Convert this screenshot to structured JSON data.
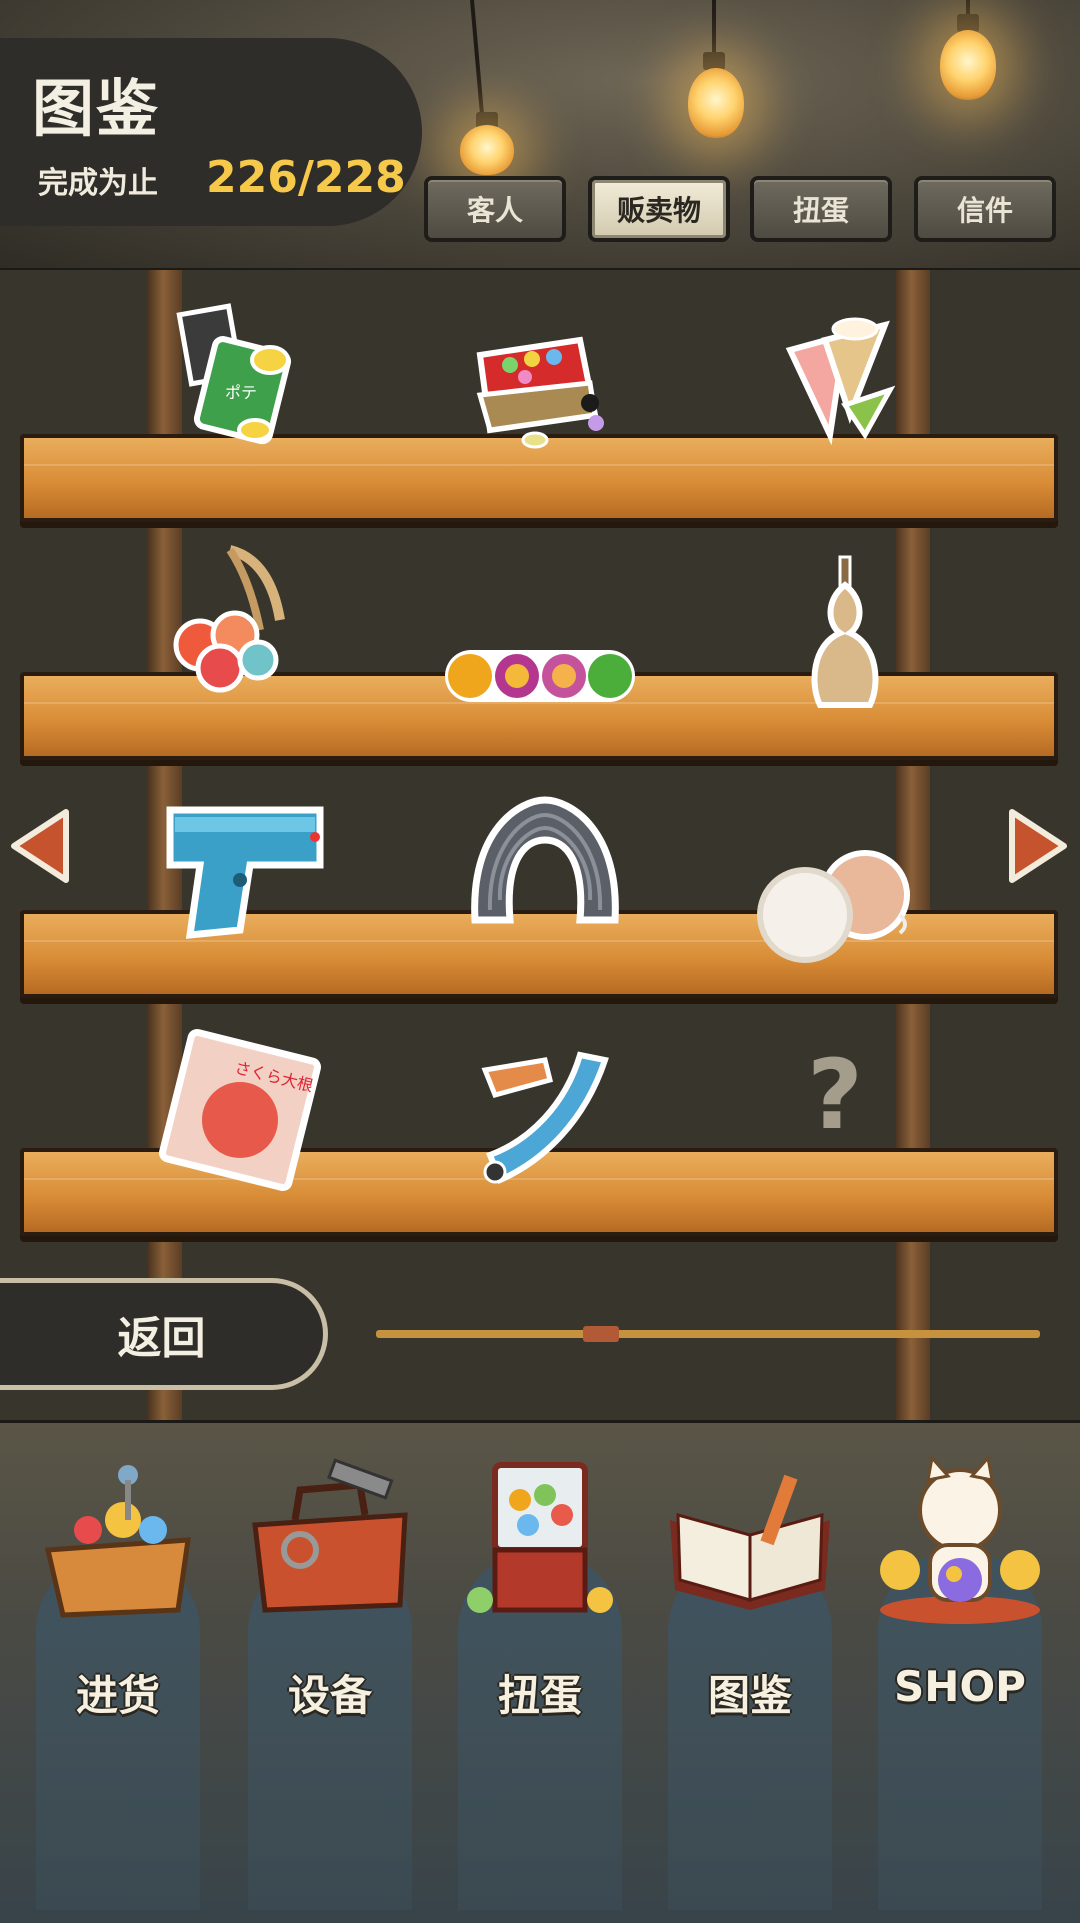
{
  "header": {
    "title": "图鉴",
    "progress_label": "完成为止",
    "progress_value": "226/228"
  },
  "tabs": [
    {
      "label": "客人",
      "active": false
    },
    {
      "label": "贩卖物",
      "active": true
    },
    {
      "label": "扭蛋",
      "active": false
    },
    {
      "label": "信件",
      "active": false
    }
  ],
  "collection": {
    "items": [
      {
        "name": "chips-bag-icon"
      },
      {
        "name": "candy-tin-icon"
      },
      {
        "name": "ice-cream-cone-icon"
      },
      {
        "name": "water-balloon-icon"
      },
      {
        "name": "candy-balls-icon"
      },
      {
        "name": "gourd-bottle-icon"
      },
      {
        "name": "water-gun-icon"
      },
      {
        "name": "slinky-spring-icon"
      },
      {
        "name": "bouncy-balls-icon"
      },
      {
        "name": "sakura-candy-bag-icon"
      },
      {
        "name": "party-blower-icon"
      },
      {
        "name": "unknown-item-icon",
        "locked": true,
        "text": "?"
      }
    ],
    "page_position": 0.33
  },
  "back_label": "返回",
  "nav": [
    {
      "label": "进货",
      "icon": "goods-basket-icon"
    },
    {
      "label": "设备",
      "icon": "toolbox-icon"
    },
    {
      "label": "扭蛋",
      "icon": "gacha-machine-icon"
    },
    {
      "label": "图鉴",
      "icon": "open-book-icon"
    },
    {
      "label": "SHOP",
      "icon": "lucky-cat-icon"
    }
  ],
  "colors": {
    "accent_yellow": "#f6c94a",
    "shelf_wood": "#d98d37",
    "arrow_red": "#c4532e"
  }
}
